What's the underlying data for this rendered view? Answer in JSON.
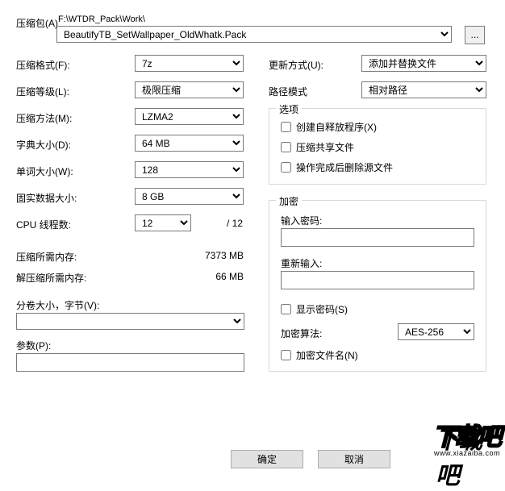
{
  "archive": {
    "label": "压缩包(A)",
    "path_text": "F:\\WTDR_Pack\\Work\\",
    "filename": "BeautifyTB_SetWallpaper_OldWhatk.Pack",
    "browse_label": "..."
  },
  "left": {
    "format_label": "压缩格式(F):",
    "format_value": "7z",
    "level_label": "压缩等级(L):",
    "level_value": "极限压缩",
    "method_label": "压缩方法(M):",
    "method_value": "LZMA2",
    "dict_label": "字典大小(D):",
    "dict_value": "64 MB",
    "word_label": "单词大小(W):",
    "word_value": "128",
    "solid_label": "固实数据大小:",
    "solid_value": "8 GB",
    "threads_label": "CPU 线程数:",
    "threads_value": "12",
    "threads_max": "/  12",
    "mem_compress_label": "压缩所需内存:",
    "mem_compress_value": "7373 MB",
    "mem_decompress_label": "解压缩所需内存:",
    "mem_decompress_value": "66 MB",
    "volume_label": "分卷大小，字节(V):",
    "volume_value": "",
    "params_label": "参数(P):",
    "params_value": ""
  },
  "right": {
    "update_label": "更新方式(U):",
    "update_value": "添加并替换文件",
    "path_mode_label": "路径模式",
    "path_mode_value": "相对路径",
    "options_title": "选项",
    "sfx_label": "创建自释放程序(X)",
    "shared_label": "压缩共享文件",
    "delete_after_label": "操作完成后删除源文件",
    "encrypt_title": "加密",
    "password_label": "输入密码:",
    "password_value": "",
    "repassword_label": "重新输入:",
    "repassword_value": "",
    "show_pwd_label": "显示密码(S)",
    "enc_method_label": "加密算法:",
    "enc_method_value": "AES-256",
    "enc_names_label": "加密文件名(N)"
  },
  "buttons": {
    "ok": "确定",
    "cancel": "取消"
  },
  "watermark": {
    "main": "下载吧",
    "sub": "www.xiazaiba.com"
  }
}
